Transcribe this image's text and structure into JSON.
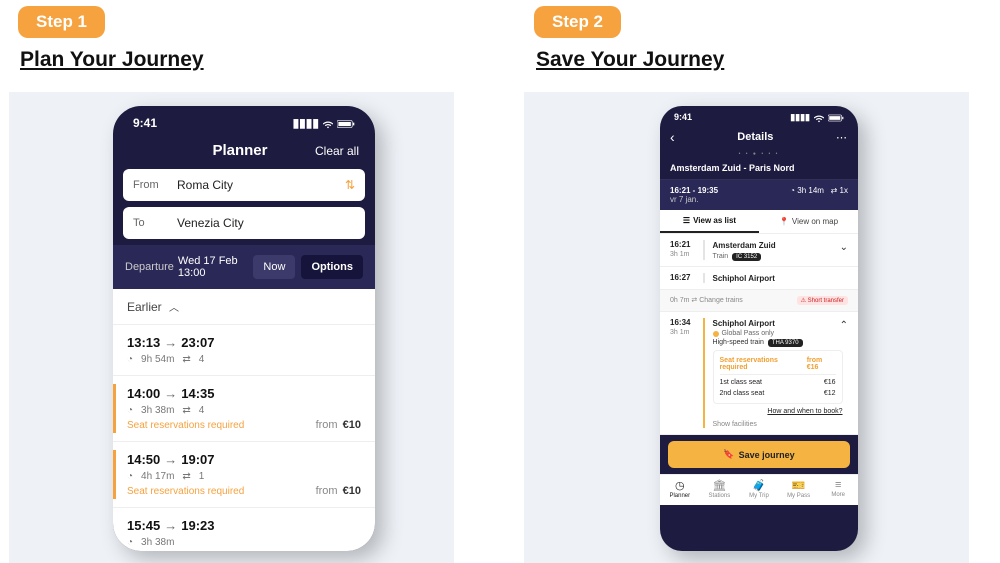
{
  "step1": {
    "badge": "Step 1",
    "title": "Plan Your Journey"
  },
  "step2": {
    "badge": "Step 2",
    "title": "Save Your Journey"
  },
  "phone1": {
    "time": "9:41",
    "header": {
      "title": "Planner",
      "clear": "Clear all"
    },
    "from_label": "From",
    "from_value": "Roma City",
    "to_label": "To",
    "to_value": "Venezia City",
    "departure_label": "Departure",
    "departure_value": "Wed 17 Feb 13:00",
    "now": "Now",
    "options": "Options",
    "earlier": "Earlier",
    "results": [
      {
        "dep": "13:13",
        "arr": "23:07",
        "duration": "9h 54m",
        "changes": "4",
        "reservation": "",
        "price": ""
      },
      {
        "dep": "14:00",
        "arr": "14:35",
        "duration": "3h 38m",
        "changes": "4",
        "reservation": "Seat reservations required",
        "price": "€10"
      },
      {
        "dep": "14:50",
        "arr": "19:07",
        "duration": "4h 17m",
        "changes": "1",
        "reservation": "Seat reservations required",
        "price": "€10"
      },
      {
        "dep": "15:45",
        "arr": "19:23",
        "duration": "3h 38m",
        "changes": "",
        "reservation": "",
        "price": ""
      }
    ],
    "price_prefix": "from"
  },
  "phone2": {
    "time": "9:41",
    "header": {
      "title": "Details"
    },
    "route": "Amsterdam Zuid - Paris Nord",
    "summary": {
      "times": "16:21 - 19:35",
      "date": "vr 7 jan.",
      "duration": "3h 14m",
      "changes": "1x"
    },
    "tabs": {
      "list": "View as list",
      "map": "View on map"
    },
    "seg1": {
      "time": "16:21",
      "dur": "3h 1m",
      "station": "Amsterdam Zuid",
      "train_label": "Train",
      "train_no": "IC 3152"
    },
    "seg2": {
      "time": "16:27",
      "station": "Schiphol Airport"
    },
    "transfer": {
      "text": "0h 7m ⇄ Change trains",
      "warning": "Short transfer"
    },
    "seg3": {
      "time": "16:34",
      "dur": "3h 1m",
      "station": "Schiphol Airport",
      "global_pass": "Global Pass only",
      "train_label": "High-speed train",
      "train_no": "THA 9370",
      "reserv_title": "Seat reservations required",
      "reserv_from": "from €16",
      "class1_label": "1st class seat",
      "class1_price": "€16",
      "class2_label": "2nd class seat",
      "class2_price": "€12",
      "howbook": "How and when to book?",
      "showfac": "Show facilities"
    },
    "save": "Save journey",
    "nav": {
      "planner": "Planner",
      "stations": "Stations",
      "mytrip": "My Trip",
      "mypass": "My Pass",
      "more": "More"
    }
  }
}
